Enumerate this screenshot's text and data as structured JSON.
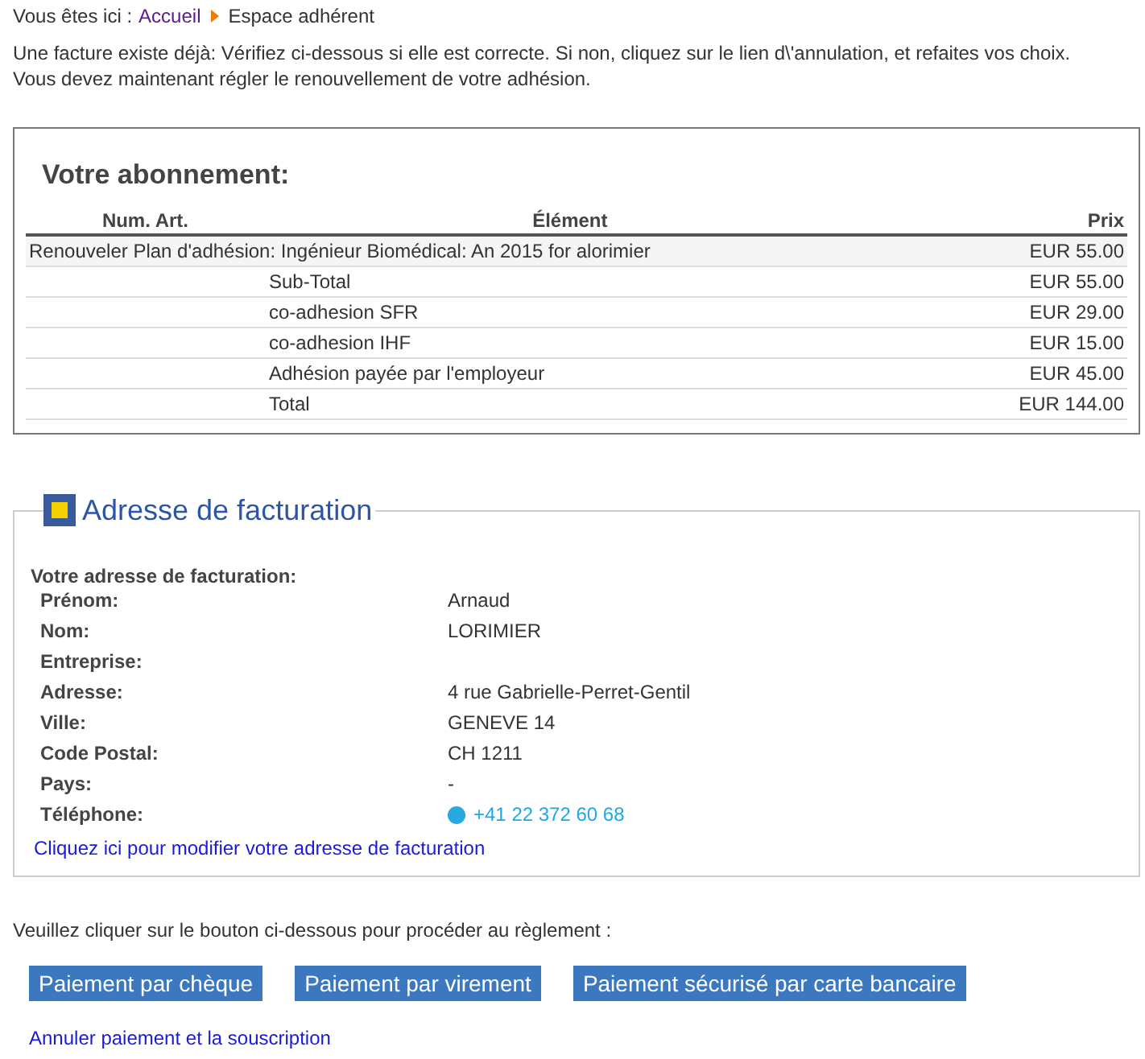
{
  "breadcrumb": {
    "prefix": "Vous êtes ici :",
    "items": [
      {
        "label": "Accueil",
        "kind": "link"
      },
      {
        "label": "Espace adhérent",
        "kind": "current"
      }
    ]
  },
  "intro": [
    "Une facture existe déjà: Vérifiez ci-dessous si elle est correcte. Si non, cliquez sur le lien d\\'annulation, et refaites vos choix.",
    "Vous devez maintenant régler le renouvellement de votre adhésion."
  ],
  "subscription": {
    "title": "Votre abonnement:",
    "columns": [
      "Num. Art.",
      "Élément",
      "Prix"
    ],
    "rows": [
      {
        "kind": "item",
        "label": "Renouveler Plan d'adhésion: Ingénieur Biomédical: An 2015 for alorimier",
        "price": "EUR 55.00"
      },
      {
        "kind": "summary",
        "label": "Sub-Total",
        "price": "EUR 55.00"
      },
      {
        "kind": "summary",
        "label": "co-adhesion SFR",
        "price": "EUR 29.00"
      },
      {
        "kind": "summary",
        "label": "co-adhesion IHF",
        "price": "EUR 15.00"
      },
      {
        "kind": "summary",
        "label": "Adhésion payée par l'employeur",
        "price": "EUR 45.00"
      },
      {
        "kind": "summary",
        "label": "Total",
        "price": "EUR 144.00"
      }
    ]
  },
  "billing": {
    "legend": "Adresse de facturation",
    "heading": "Votre adresse de facturation:",
    "fields": [
      {
        "label": "Prénom:",
        "value": "Arnaud",
        "kind": "text"
      },
      {
        "label": "Nom:",
        "value": "LORIMIER",
        "kind": "text"
      },
      {
        "label": "Entreprise:",
        "kind": "text"
      },
      {
        "label": "Adresse:",
        "value": "4 rue Gabrielle-Perret-Gentil",
        "kind": "text"
      },
      {
        "label": "Ville:",
        "value": "GENEVE 14",
        "kind": "text"
      },
      {
        "label": "Code Postal:",
        "value": "CH 1211",
        "kind": "text"
      },
      {
        "label": "Pays:",
        "value": "-",
        "kind": "text"
      },
      {
        "label": "Téléphone:",
        "value": "+41 22 372 60 68",
        "kind": "phone"
      }
    ],
    "edit_link": "Cliquez ici pour modifier votre adresse de facturation"
  },
  "payment": {
    "instruction": "Veuillez cliquer sur le bouton ci-dessous pour procéder au règlement :",
    "buttons": [
      "Paiement par chèque",
      "Paiement par virement",
      "Paiement sécurisé par carte bancaire"
    ],
    "cancel_link": "Annuler paiement et la souscription"
  }
}
